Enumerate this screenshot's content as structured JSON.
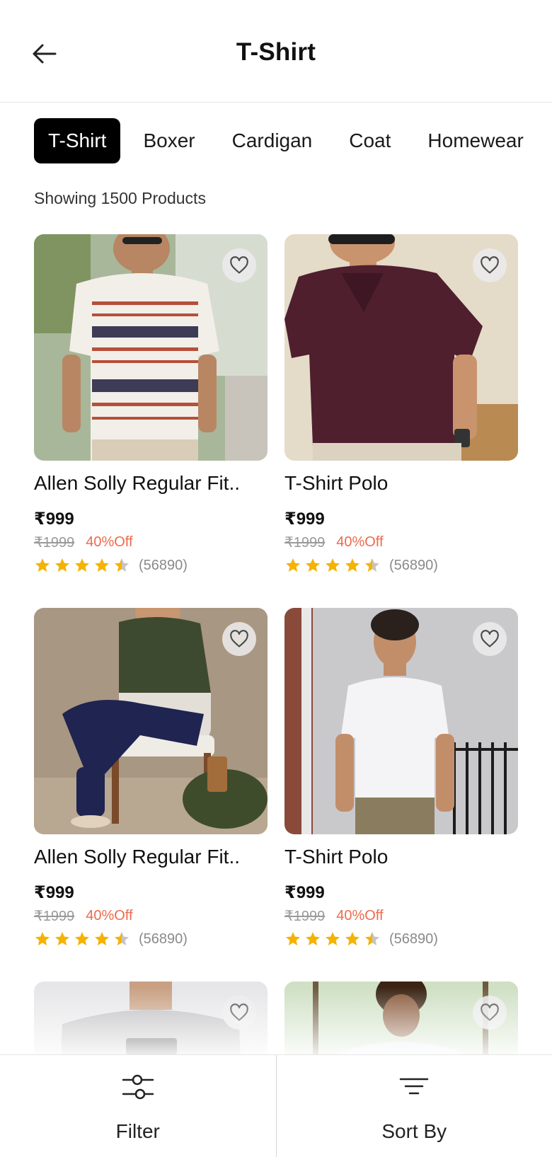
{
  "header": {
    "title": "T-Shirt",
    "back_icon": "arrow-left-icon"
  },
  "tabs": [
    {
      "label": "T-Shirt",
      "active": true
    },
    {
      "label": "Boxer",
      "active": false
    },
    {
      "label": "Cardigan",
      "active": false
    },
    {
      "label": "Coat",
      "active": false
    },
    {
      "label": "Homewear",
      "active": false
    }
  ],
  "results": {
    "count_text": "Showing 1500 Products"
  },
  "products": [
    {
      "title": "Allen Solly Regular Fit..",
      "price": "₹999",
      "original_price": "₹1999",
      "discount": "40%Off",
      "rating": 4.5,
      "reviews": "(56890)"
    },
    {
      "title": "T-Shirt Polo",
      "price": "₹999",
      "original_price": "₹1999",
      "discount": "40%Off",
      "rating": 4.5,
      "reviews": "(56890)"
    },
    {
      "title": "Allen Solly Regular Fit..",
      "price": "₹999",
      "original_price": "₹1999",
      "discount": "40%Off",
      "rating": 4.5,
      "reviews": "(56890)"
    },
    {
      "title": "T-Shirt Polo",
      "price": "₹999",
      "original_price": "₹1999",
      "discount": "40%Off",
      "rating": 4.5,
      "reviews": "(56890)"
    },
    {
      "title": "",
      "price": "",
      "original_price": "",
      "discount": "",
      "rating": null,
      "reviews": ""
    },
    {
      "title": "",
      "price": "",
      "original_price": "",
      "discount": "",
      "rating": null,
      "reviews": ""
    }
  ],
  "bottom_bar": {
    "filter": {
      "label": "Filter",
      "icon": "sliders-icon"
    },
    "sort": {
      "label": "Sort By",
      "icon": "sort-lines-icon"
    }
  },
  "colors": {
    "accent": "#000000",
    "discount": "#ee6a4c",
    "star": "#f5b301",
    "star_empty": "#c4c4c4",
    "muted": "#9a9a9a"
  }
}
